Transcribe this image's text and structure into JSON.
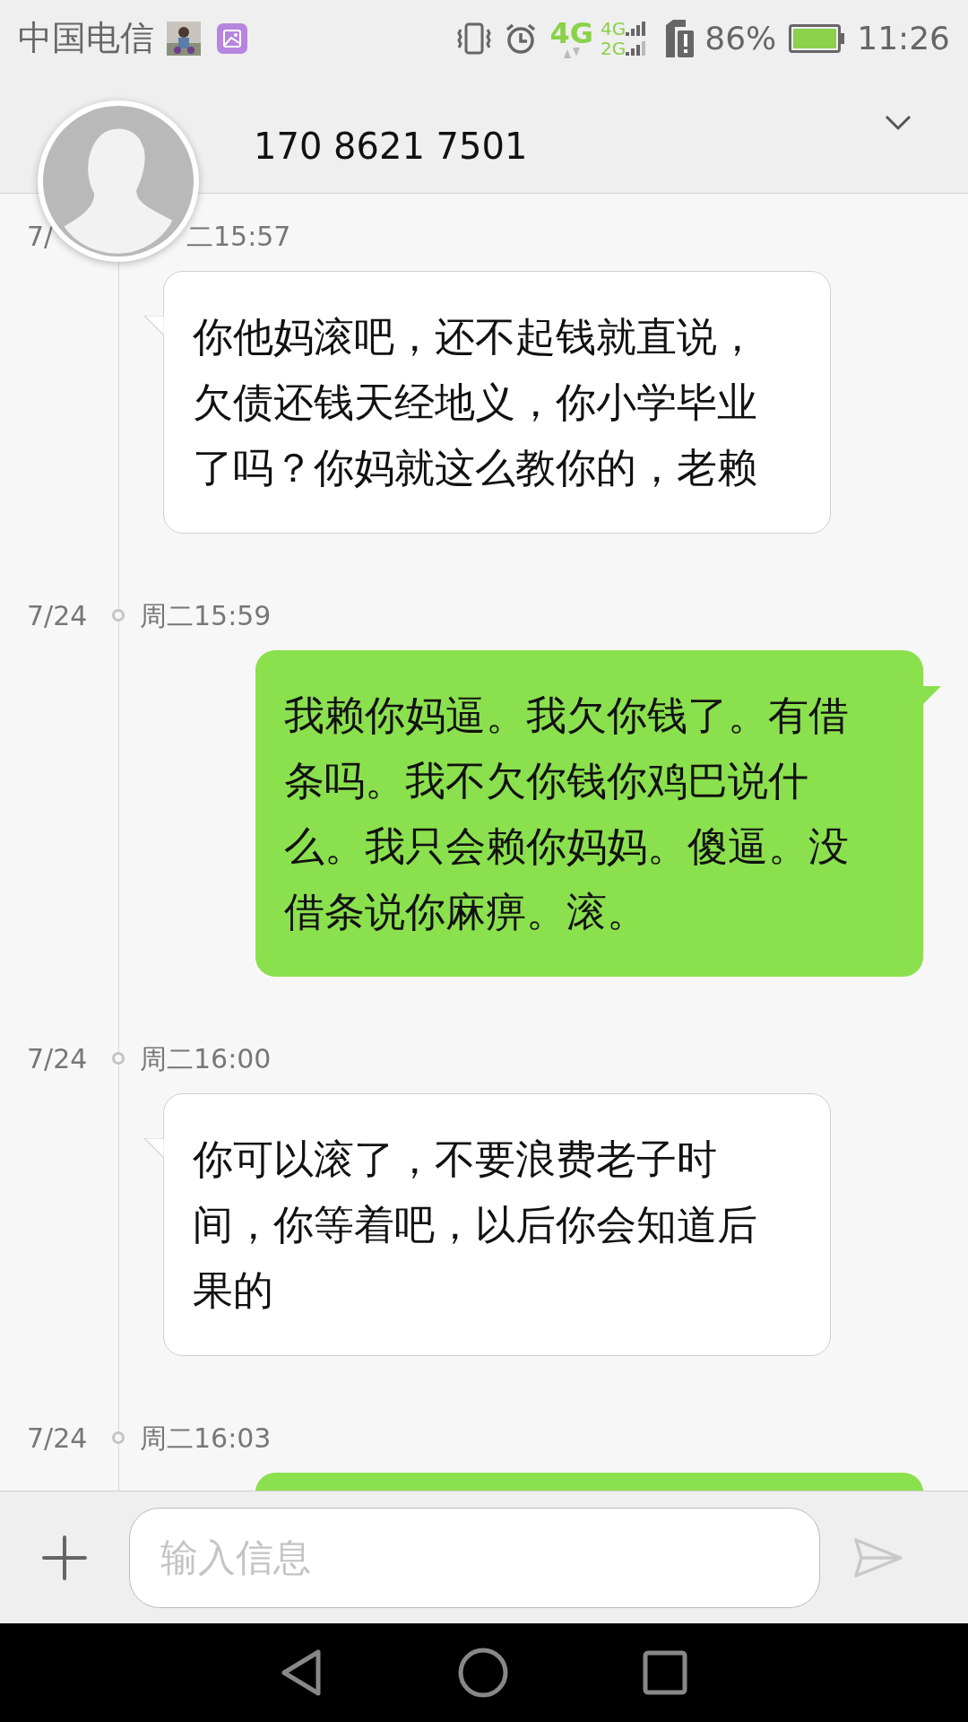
{
  "status_bar": {
    "carrier": "中国电信",
    "network": "4G",
    "network_secondary": [
      "4G",
      "2G"
    ],
    "battery_percent": "86%",
    "time": "11:26"
  },
  "header": {
    "contact": "170 8621 7501"
  },
  "messages": [
    {
      "date": "7/",
      "time": "二15:57",
      "kind": "received",
      "lines": [
        "你他妈滚吧，还不起钱就直说，",
        "欠债还钱天经地义，你小学毕业",
        "了吗？你妈就这么教你的，老赖"
      ]
    },
    {
      "date": "7/24",
      "time": "周二15:59",
      "kind": "sent",
      "lines": [
        "我赖你妈逼。我欠你钱了。有借",
        "条吗。我不欠你钱你鸡巴说什",
        "么。我只会赖你妈妈。傻逼。没",
        "借条说你麻痹。滚。"
      ]
    },
    {
      "date": "7/24",
      "time": "周二16:00",
      "kind": "received",
      "lines": [
        "你可以滚了，不要浪费老子时",
        "间，你等着吧，以后你会知道后",
        "果的"
      ]
    },
    {
      "date": "7/24",
      "time": "周二16:03",
      "kind": "sent"
    }
  ],
  "composer": {
    "placeholder": "输入信息"
  }
}
